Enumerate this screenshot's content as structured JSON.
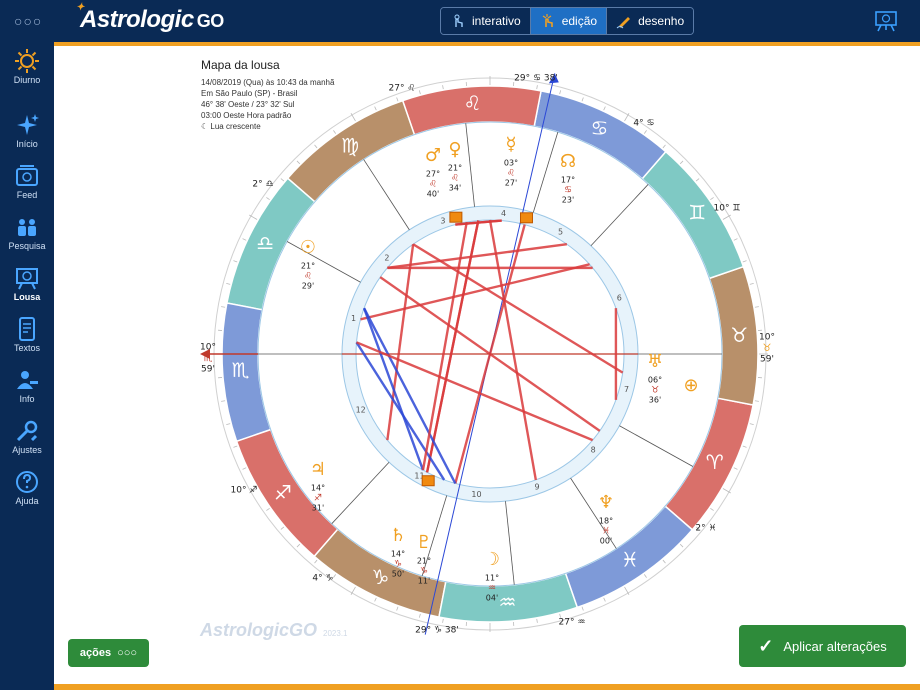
{
  "topbar": {
    "logo_main": "Astrologic",
    "logo_suffix": "GO",
    "modes": [
      {
        "label": "interativo",
        "icon": "touch-icon"
      },
      {
        "label": "edição",
        "icon": "tap-edit-icon"
      },
      {
        "label": "desenho",
        "icon": "pen-draw-icon"
      }
    ],
    "active_mode": "edição"
  },
  "sidebar": {
    "items": [
      {
        "label": "Diurno",
        "icon": "sun-icon"
      },
      {
        "label": "Início",
        "icon": "sparkle-icon"
      },
      {
        "label": "Feed",
        "icon": "feed-icon"
      },
      {
        "label": "Pesquisa",
        "icon": "people-icon"
      },
      {
        "label": "Lousa",
        "icon": "board-icon"
      },
      {
        "label": "Textos",
        "icon": "document-icon"
      },
      {
        "label": "Info",
        "icon": "user-info-icon"
      },
      {
        "label": "Ajustes",
        "icon": "tools-icon"
      },
      {
        "label": "Ajuda",
        "icon": "help-icon"
      }
    ],
    "active": "Lousa"
  },
  "info": {
    "title": "Mapa da lousa",
    "date_line": "14/08/2019 (Qua) às 10:43 da manhã",
    "place_line": "Em São Paulo (SP) - Brasil",
    "coords_line": "46° 38' Oeste / 23° 32' Sul",
    "tz_line": "03:00 Oeste Hora padrão",
    "moon_line": "Lua crescente"
  },
  "chart_labels": {
    "asc_top": "10°",
    "asc_sign": "♏",
    "asc_bottom": "59'",
    "desc_top": "10°",
    "desc_sign": "♉",
    "desc_bottom": "59'",
    "mc": "29° ♋ 38'",
    "ic": "29° ♑ 38'",
    "cusps": [
      "27° ♌",
      "4° ♋",
      "10° ♊",
      "2° ♓",
      "27° ♒",
      "4° ♑",
      "10° ♐",
      "2° ♎"
    ],
    "houses": [
      "1",
      "2",
      "3",
      "4",
      "5",
      "6",
      "7",
      "8",
      "9",
      "10",
      "11",
      "12"
    ],
    "planets": [
      {
        "glyph": "♂",
        "deg": "27°",
        "sign": "♌",
        "min": "40'"
      },
      {
        "glyph": "♀",
        "deg": "21°",
        "sign": "♌",
        "min": "34'"
      },
      {
        "glyph": "☉",
        "deg": "21°",
        "sign": "♌",
        "min": "29'"
      },
      {
        "glyph": "☿",
        "deg": "03°",
        "sign": "♌",
        "min": "27'"
      },
      {
        "glyph": "☊",
        "deg": "17°",
        "sign": "♋",
        "min": "23'"
      },
      {
        "glyph": "♅",
        "deg": "06°",
        "sign": "♉",
        "min": "36'"
      },
      {
        "glyph": "⊕",
        "deg": "",
        "sign": "",
        "min": ""
      },
      {
        "glyph": "♆",
        "deg": "18°",
        "sign": "♓",
        "min": "00'"
      },
      {
        "glyph": "☽",
        "deg": "11°",
        "sign": "♒",
        "min": "04'"
      },
      {
        "glyph": "♇",
        "deg": "21°",
        "sign": "♑",
        "min": "11'"
      },
      {
        "glyph": "♄",
        "deg": "14°",
        "sign": "♑",
        "min": "50'"
      },
      {
        "glyph": "♃",
        "deg": "14°",
        "sign": "♐",
        "min": "31'"
      }
    ]
  },
  "footer": {
    "actions_label": "ações",
    "apply_label": "Aplicar alterações",
    "watermark_main": "Astrologic",
    "watermark_suffix": "GO",
    "watermark_year": "2023.1"
  },
  "colors": {
    "fire": "#d9706a",
    "earth": "#b8906a",
    "air": "#7fc9c4",
    "water": "#7e9ad8",
    "aspect_red": "#d9393b",
    "aspect_blue": "#2b48d6",
    "accent": "#f0a022",
    "apply_green": "#2e8b3a"
  }
}
